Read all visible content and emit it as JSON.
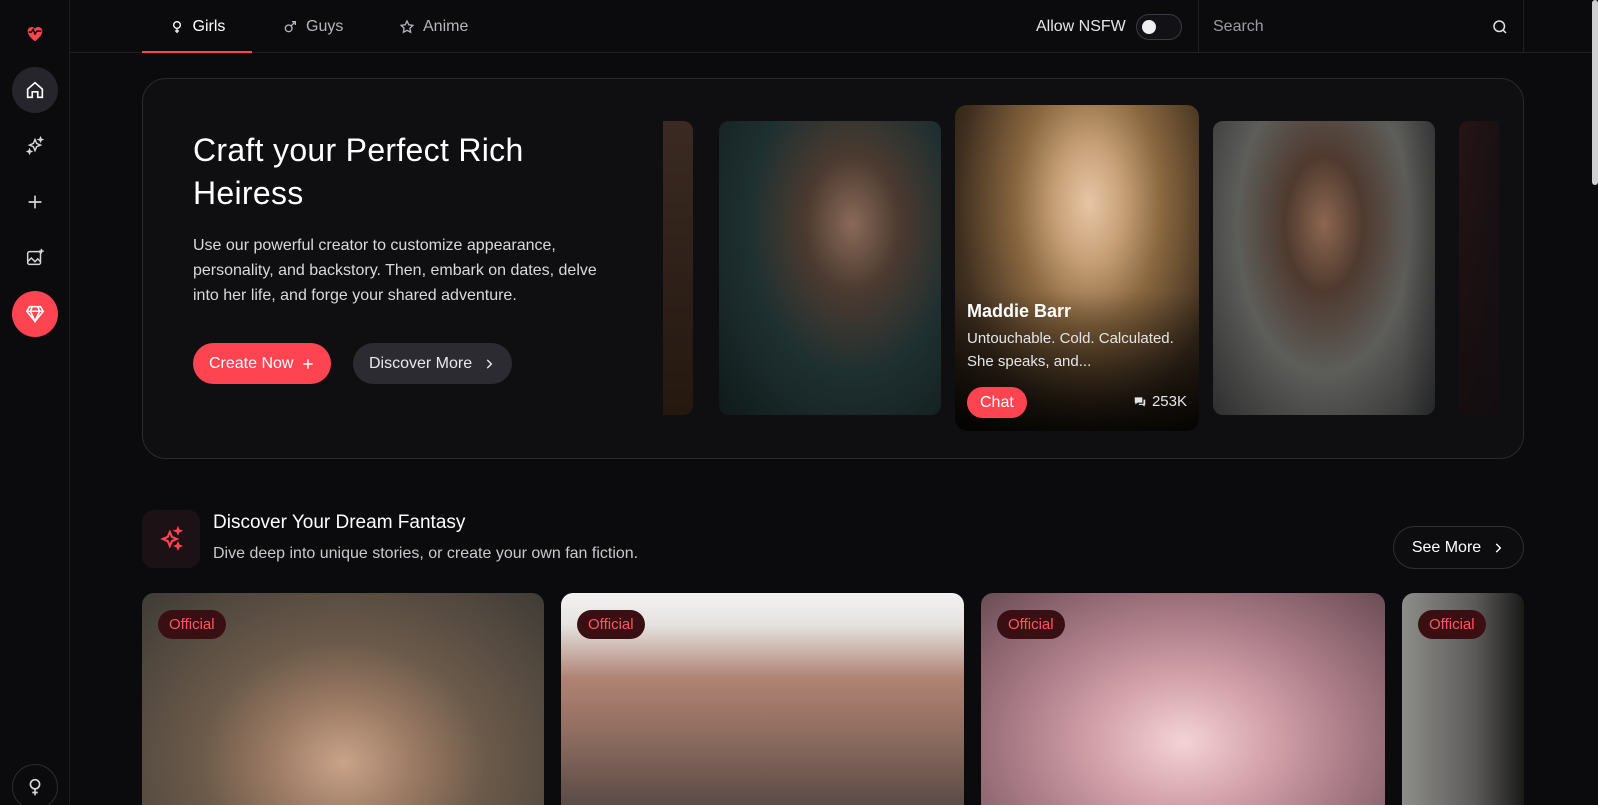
{
  "tabs": [
    {
      "label": "Girls",
      "icon": "female-icon",
      "active": true
    },
    {
      "label": "Guys",
      "icon": "male-icon",
      "active": false
    },
    {
      "label": "Anime",
      "icon": "star-icon",
      "active": false
    }
  ],
  "nsfw": {
    "label": "Allow NSFW",
    "enabled": false
  },
  "search": {
    "placeholder": "Search"
  },
  "hero": {
    "title": "Craft your Perfect Rich Heiress",
    "description": "Use our powerful creator to customize appearance, personality, and backstory. Then, embark on dates, delve into her life, and forge your shared adventure.",
    "create_label": "Create Now",
    "discover_label": "Discover More",
    "featured": {
      "name": "Maddie Barr",
      "description": "Untouchable. Cold. Calculated. She speaks, and...",
      "chat_label": "Chat",
      "count": "253K"
    }
  },
  "section": {
    "title": "Discover Your Dream Fantasy",
    "subtitle": "Dive deep into unique stories, or create your own fan fiction.",
    "see_more_label": "See More",
    "cards": [
      {
        "badge": "Official"
      },
      {
        "badge": "Official"
      },
      {
        "badge": "Official"
      },
      {
        "badge": "Official"
      }
    ]
  },
  "colors": {
    "accent": "#ff4451",
    "background": "#0b0b0e"
  }
}
